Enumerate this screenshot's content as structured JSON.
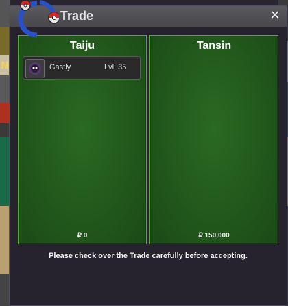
{
  "window": {
    "title": "Trade",
    "close_icon": "close-icon",
    "logo_icon": "pokeball-logo-icon"
  },
  "background": {
    "left_letter": "N"
  },
  "left_panel": {
    "player_name": "Taiju",
    "items": [
      {
        "name": "Gastly",
        "level_text": "Lvl: 35",
        "icon": "gastly-icon"
      }
    ],
    "money": "₽ 0"
  },
  "right_panel": {
    "player_name": "Tansin",
    "items": [],
    "money": "₽ 150,000"
  },
  "notice": "Please check over the Trade carefully before accepting.",
  "colors": {
    "panel_green": "#22581c",
    "panel_border": "#4fb030",
    "window_bg": "#26222e",
    "titlebar": "#505054"
  }
}
